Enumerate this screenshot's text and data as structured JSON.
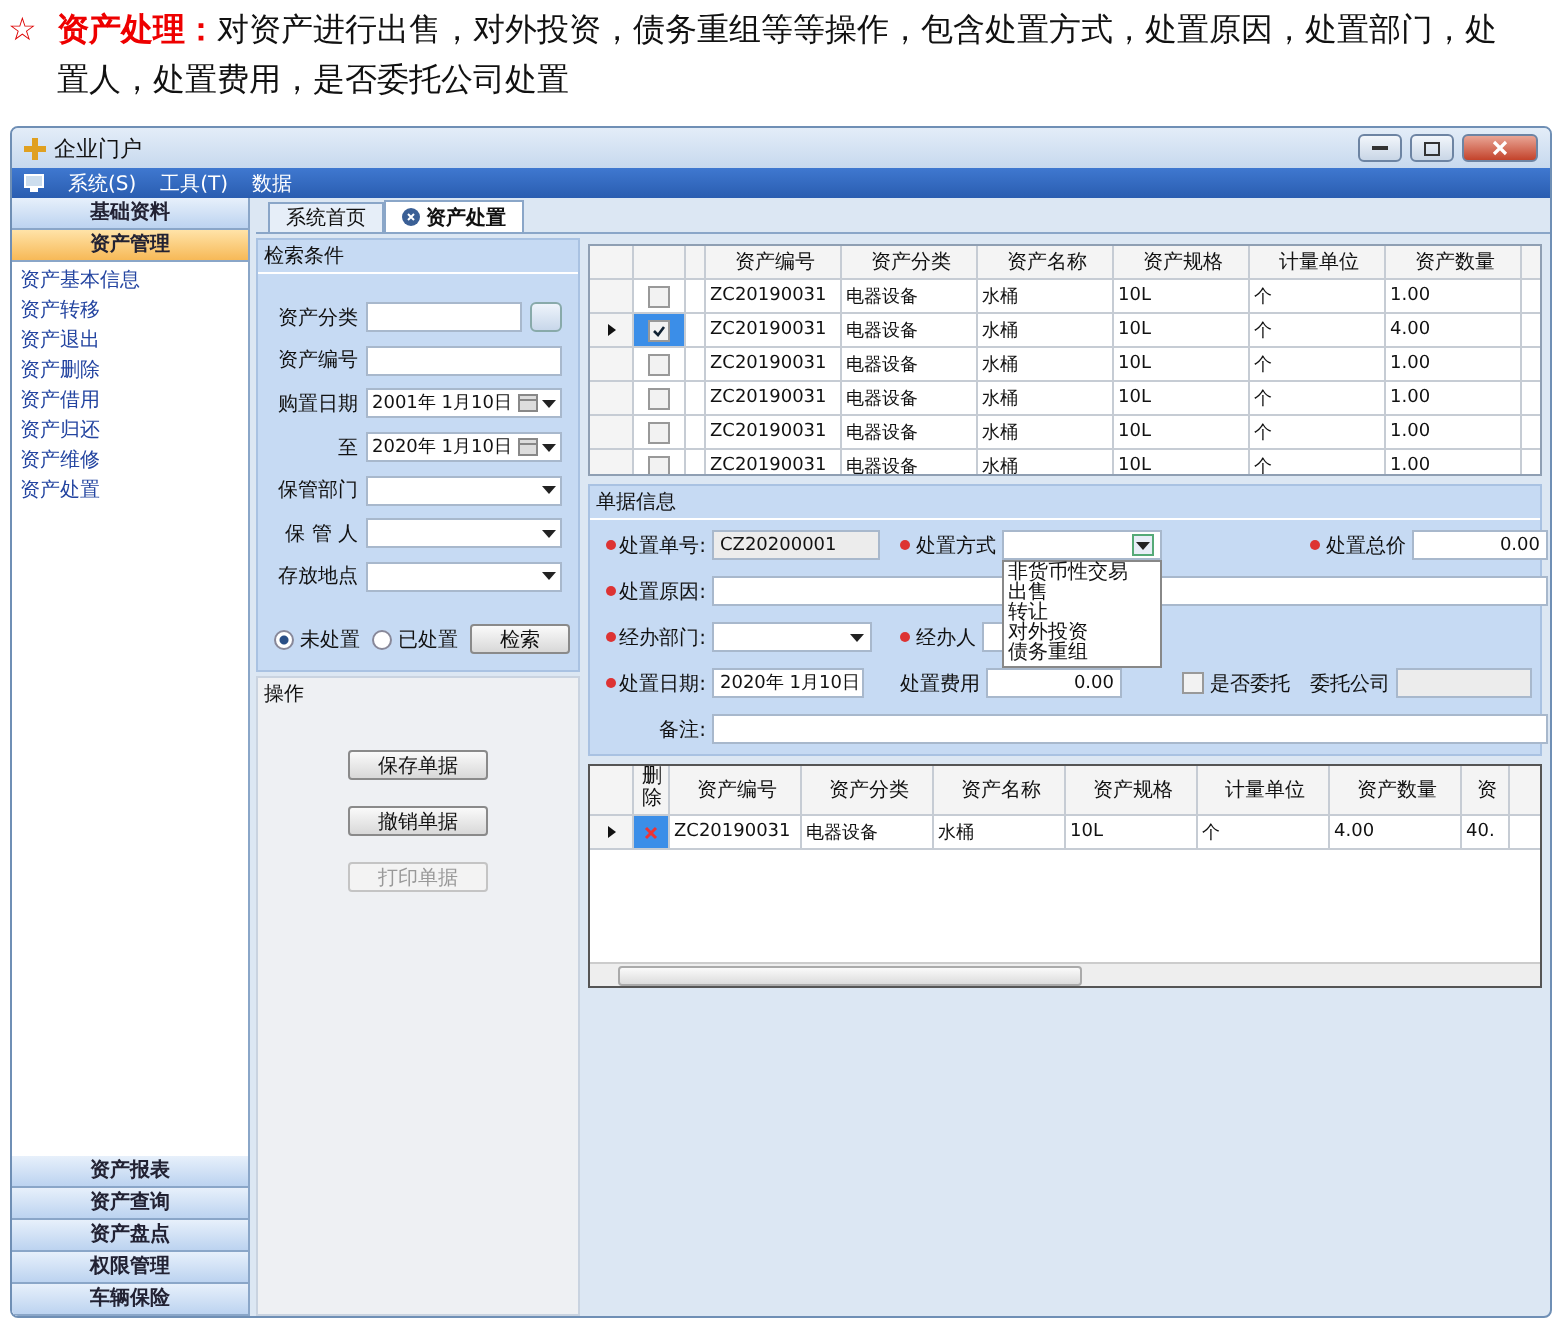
{
  "intro": {
    "marker": "☆",
    "heading": "资产处理：",
    "text": "对资产进行出售，对外投资，债务重组等等操作，包含处置方式，处置原因，处置部门，处置人，处置费用，是否委托公司处置"
  },
  "window": {
    "title": "企业门户"
  },
  "menu": [
    {
      "label": "系统(S)"
    },
    {
      "label": "工具(T)"
    },
    {
      "label": "数据"
    }
  ],
  "sidebar": {
    "top_groups": [
      {
        "label": "基础资料",
        "selected": false
      },
      {
        "label": "资产管理",
        "selected": true
      }
    ],
    "items": [
      {
        "label": "资产基本信息"
      },
      {
        "label": "资产转移"
      },
      {
        "label": "资产退出"
      },
      {
        "label": "资产删除"
      },
      {
        "label": "资产借用"
      },
      {
        "label": "资产归还"
      },
      {
        "label": "资产维修"
      },
      {
        "label": "资产处置"
      }
    ],
    "bottom_groups": [
      {
        "label": "资产报表",
        "selected": false
      },
      {
        "label": "资产查询",
        "selected": false
      },
      {
        "label": "资产盘点",
        "selected": false
      },
      {
        "label": "权限管理",
        "selected": false
      },
      {
        "label": "车辆保险",
        "selected": false
      }
    ]
  },
  "tabs": [
    {
      "label": "系统首页",
      "selected": false,
      "closable": false
    },
    {
      "label": "资产处置",
      "selected": true,
      "closable": true
    }
  ],
  "search": {
    "title": "检索条件",
    "fields": [
      {
        "label": "资产分类",
        "kind": "picker"
      },
      {
        "label": "资产编号",
        "kind": "text"
      },
      {
        "label": "购置日期",
        "kind": "date",
        "value": "2001年 1月10日"
      },
      {
        "label": "至",
        "kind": "date",
        "value": "2020年 1月10日"
      },
      {
        "label": "保管部门",
        "kind": "combo"
      },
      {
        "label": "保 管 人",
        "kind": "combo"
      },
      {
        "label": "存放地点",
        "kind": "combo"
      }
    ],
    "radios": [
      {
        "label": "未处置",
        "selected": true
      },
      {
        "label": "已处置",
        "selected": false
      }
    ],
    "button": "检索"
  },
  "operations": {
    "title": "操作",
    "buttons": [
      {
        "label": "保存单据",
        "disabled": false
      },
      {
        "label": "撤销单据",
        "disabled": false
      },
      {
        "label": "打印单据",
        "disabled": true
      }
    ]
  },
  "asset_grid": {
    "columns": [
      "资产编号",
      "资产分类",
      "资产名称",
      "资产规格",
      "计量单位",
      "资产数量"
    ],
    "rows": [
      {
        "current": false,
        "checked": false,
        "cells": [
          "ZC20190031",
          "电器设备",
          "水桶",
          "10L",
          "个",
          "1.00"
        ]
      },
      {
        "current": true,
        "checked": true,
        "cells": [
          "ZC20190031",
          "电器设备",
          "水桶",
          "10L",
          "个",
          "4.00"
        ]
      },
      {
        "current": false,
        "checked": false,
        "cells": [
          "ZC20190031",
          "电器设备",
          "水桶",
          "10L",
          "个",
          "1.00"
        ]
      },
      {
        "current": false,
        "checked": false,
        "cells": [
          "ZC20190031",
          "电器设备",
          "水桶",
          "10L",
          "个",
          "1.00"
        ]
      },
      {
        "current": false,
        "checked": false,
        "cells": [
          "ZC20190031",
          "电器设备",
          "水桶",
          "10L",
          "个",
          "1.00"
        ]
      },
      {
        "current": false,
        "checked": false,
        "cells": [
          "ZC20190031",
          "电器设备",
          "水桶",
          "10L",
          "个",
          "1.00"
        ]
      }
    ]
  },
  "form": {
    "title": "单据信息",
    "rows": [
      {
        "fields": [
          {
            "label": "处置单号:",
            "required": true,
            "kind": "readonly",
            "value": "CZ20200001"
          },
          {
            "label": "处置方式",
            "required": true,
            "kind": "combo",
            "expanded": true,
            "options": [
              "非货币性交易",
              "出售",
              "转让",
              "对外投资",
              "债务重组"
            ]
          },
          {
            "label": "处置总价",
            "required": true,
            "kind": "amount",
            "value": "0.00"
          }
        ]
      },
      {
        "fields": [
          {
            "label": "处置原因:",
            "required": true,
            "kind": "wide"
          }
        ]
      },
      {
        "fields": [
          {
            "label": "经办部门:",
            "required": true,
            "kind": "combo",
            "expanded": false
          },
          {
            "label": "经办人",
            "required": true,
            "kind": "text"
          }
        ]
      },
      {
        "fields": [
          {
            "label": "处置日期:",
            "required": true,
            "kind": "date",
            "value": "2020年 1月10日"
          },
          {
            "label": "处置费用",
            "required": false,
            "kind": "amount",
            "value": "0.00"
          },
          {
            "label": "是否委托",
            "required": false,
            "kind": "check",
            "checked": false
          },
          {
            "label": "委托公司",
            "required": false,
            "kind": "disabled"
          }
        ]
      },
      {
        "fields": [
          {
            "label": "备注:",
            "required": false,
            "kind": "wide"
          }
        ]
      }
    ]
  },
  "detail_grid": {
    "delete_column": "删除",
    "columns": [
      "资产编号",
      "资产分类",
      "资产名称",
      "资产规格",
      "计量单位",
      "资产数量",
      "资"
    ],
    "rows": [
      {
        "current": true,
        "cells": [
          "ZC20190031",
          "电器设备",
          "水桶",
          "10L",
          "个",
          "4.00",
          "40."
        ]
      }
    ]
  }
}
